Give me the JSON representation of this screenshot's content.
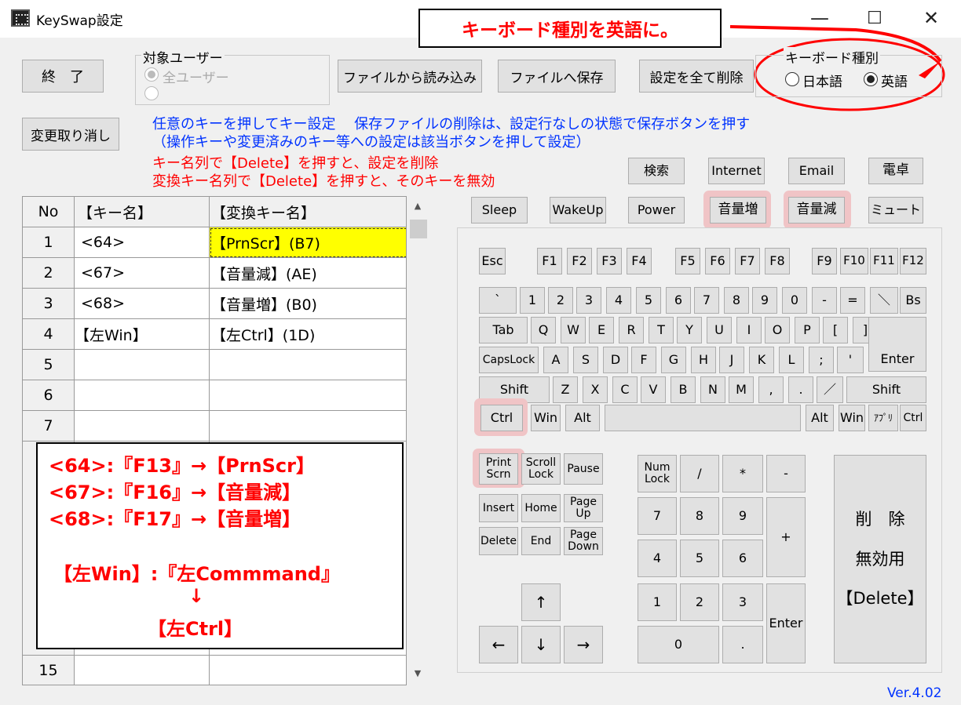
{
  "window": {
    "title": "KeySwap設定",
    "minimize": "—",
    "maximize": "☐",
    "close": "✕"
  },
  "toolbar": {
    "exit": "終　了",
    "undo": "変更取り消し",
    "load": "ファイルから読み込み",
    "save": "ファイルへ保存",
    "delete_all": "設定を全て削除"
  },
  "target_user": {
    "label": "対象ユーザー",
    "option_all": "全ユーザー",
    "selected": "all"
  },
  "keyboard_type": {
    "label": "キーボード種別",
    "option_ja": "日本語",
    "option_en": "英語",
    "selected": "en"
  },
  "help": {
    "blue_1": "任意のキーを押してキー設定　 保存ファイルの削除は、設定行なしの状態で保存ボタンを押す",
    "blue_2": "（操作キーや変更済みのキー等への設定は該当ボタンを押して設定）",
    "red_1": "キー名列で【Delete】を押すと、設定を削除",
    "red_2": "変換キー名列で【Delete】を押すと、そのキーを無効"
  },
  "table": {
    "headers": [
      "No",
      "【キー名】",
      "【変換キー名】"
    ],
    "rows": [
      {
        "no": "1",
        "key": "<64>",
        "mapped": "【PrnScr】(B7)"
      },
      {
        "no": "2",
        "key": "<67>",
        "mapped": "【音量減】(AE)"
      },
      {
        "no": "3",
        "key": "<68>",
        "mapped": "【音量増】(B0)"
      },
      {
        "no": "4",
        "key": "【左Win】",
        "mapped": "【左Ctrl】(1D)"
      },
      {
        "no": "5",
        "key": "",
        "mapped": ""
      },
      {
        "no": "6",
        "key": "",
        "mapped": ""
      },
      {
        "no": "7",
        "key": "",
        "mapped": ""
      },
      {
        "no": "15",
        "key": "",
        "mapped": ""
      }
    ]
  },
  "scroll": {
    "up": "▲",
    "down": "▼"
  },
  "special_keys": {
    "search": "検索",
    "internet": "Internet",
    "email": "Email",
    "calc": "電卓",
    "sleep": "Sleep",
    "wakeup": "WakeUp",
    "power": "Power",
    "vol_up": "音量増",
    "vol_down": "音量減",
    "mute": "ミュート"
  },
  "keys": {
    "esc": "Esc",
    "f": [
      "F1",
      "F2",
      "F3",
      "F4",
      "F5",
      "F6",
      "F7",
      "F8",
      "F9",
      "F10",
      "F11",
      "F12"
    ],
    "num_row": [
      "`",
      "1",
      "2",
      "3",
      "4",
      "5",
      "6",
      "7",
      "8",
      "9",
      "0",
      "-",
      "=",
      "＼",
      "Bs"
    ],
    "tab": "Tab",
    "q_row": [
      "Q",
      "W",
      "E",
      "R",
      "T",
      "Y",
      "U",
      "I",
      "O",
      "P",
      "[",
      "]"
    ],
    "enter": "Enter",
    "caps": "CapsLock",
    "a_row": [
      "A",
      "S",
      "D",
      "F",
      "G",
      "H",
      "J",
      "K",
      "L",
      ";",
      "'"
    ],
    "shift_l": "Shift",
    "z_row": [
      "Z",
      "X",
      "C",
      "V",
      "B",
      "N",
      "M",
      ",",
      ".",
      "／"
    ],
    "shift_r": "Shift",
    "ctrl_l": "Ctrl",
    "win_l": "Win",
    "alt_l": "Alt",
    "space": "",
    "alt_r": "Alt",
    "win_r": "Win",
    "app": "ｱﾌﾟﾘ",
    "ctrl_r": "Ctrl",
    "print_1": "Print",
    "print_2": "Scrn",
    "scroll_1": "Scroll",
    "scroll_2": "Lock",
    "pause": "Pause",
    "insert": "Insert",
    "home": "Home",
    "pgup_1": "Page",
    "pgup_2": "Up",
    "delete": "Delete",
    "end": "End",
    "pgdn_1": "Page",
    "pgdn_2": "Down",
    "up": "↑",
    "left": "←",
    "down": "↓",
    "right": "→",
    "numlock_1": "Num",
    "numlock_2": "Lock",
    "np_div": "/",
    "np_mul": "*",
    "np_sub": "-",
    "np_add": "+",
    "np7": "7",
    "np8": "8",
    "np9": "9",
    "np4": "4",
    "np5": "5",
    "np6": "6",
    "np1": "1",
    "np2": "2",
    "np3": "3",
    "np0": "0",
    "np_dot": ".",
    "np_enter": "Enter"
  },
  "delete_panel": {
    "line1": "削　除",
    "line2": "無効用",
    "line3": "【Delete】"
  },
  "annotation": {
    "l1": "<64>:『F13』→【PrnScr】",
    "l2": "<67>:『F16』→【音量減】",
    "l3": "<68>:『F17』→【音量増】",
    "l4": "【左Win】:『左Commmand』",
    "arrow": "↓",
    "l5": "【左Ctrl】"
  },
  "callout": "キーボード種別を英語に。",
  "version": "Ver.4.02",
  "colors": {
    "highlight": "#f0c4c6",
    "selection": "#ffff00",
    "annotation_red": "#ff0000",
    "help_blue": "#0033ff"
  }
}
